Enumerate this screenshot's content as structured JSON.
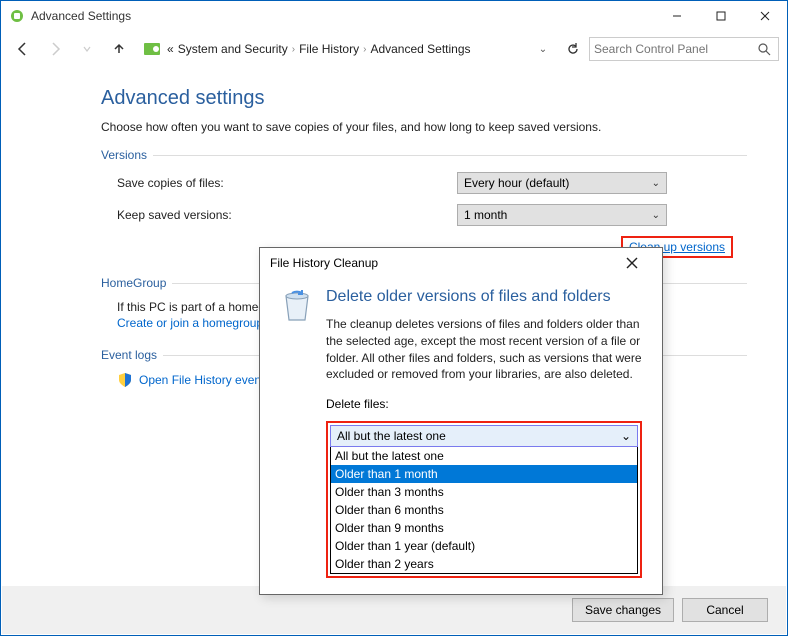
{
  "window": {
    "title": "Advanced Settings"
  },
  "breadcrumbs": {
    "prefix": "«",
    "parts": [
      "System and Security",
      "File History",
      "Advanced Settings"
    ]
  },
  "search": {
    "placeholder": "Search Control Panel"
  },
  "page": {
    "heading": "Advanced settings",
    "subtitle": "Choose how often you want to save copies of your files, and how long to keep saved versions."
  },
  "versions": {
    "legend": "Versions",
    "save_label": "Save copies of files:",
    "save_value": "Every hour (default)",
    "keep_label": "Keep saved versions:",
    "keep_value": "1 month",
    "cleanup_link": "Clean up versions"
  },
  "homegroup": {
    "legend": "HomeGroup",
    "line1": "If this PC is part of a homegroup, you can recommend this drive to other homegroup members.",
    "link": "Create or join a homegroup"
  },
  "eventlogs": {
    "legend": "Event logs",
    "link": "Open File History event logs to view recent events or errors"
  },
  "buttons": {
    "save": "Save changes",
    "cancel": "Cancel"
  },
  "dialog": {
    "title": "File History Cleanup",
    "heading": "Delete older versions of files and folders",
    "description": "The cleanup deletes versions of files and folders older than the selected age, except the most recent version of a file or folder. All other files and folders, such as versions that were excluded or removed from your libraries, are also deleted.",
    "label": "Delete files:",
    "selected": "All but the latest one",
    "options": [
      "All but the latest one",
      "Older than 1 month",
      "Older than 3 months",
      "Older than 6 months",
      "Older than 9 months",
      "Older than 1 year (default)",
      "Older than 2 years"
    ],
    "highlighted_index": 1
  }
}
